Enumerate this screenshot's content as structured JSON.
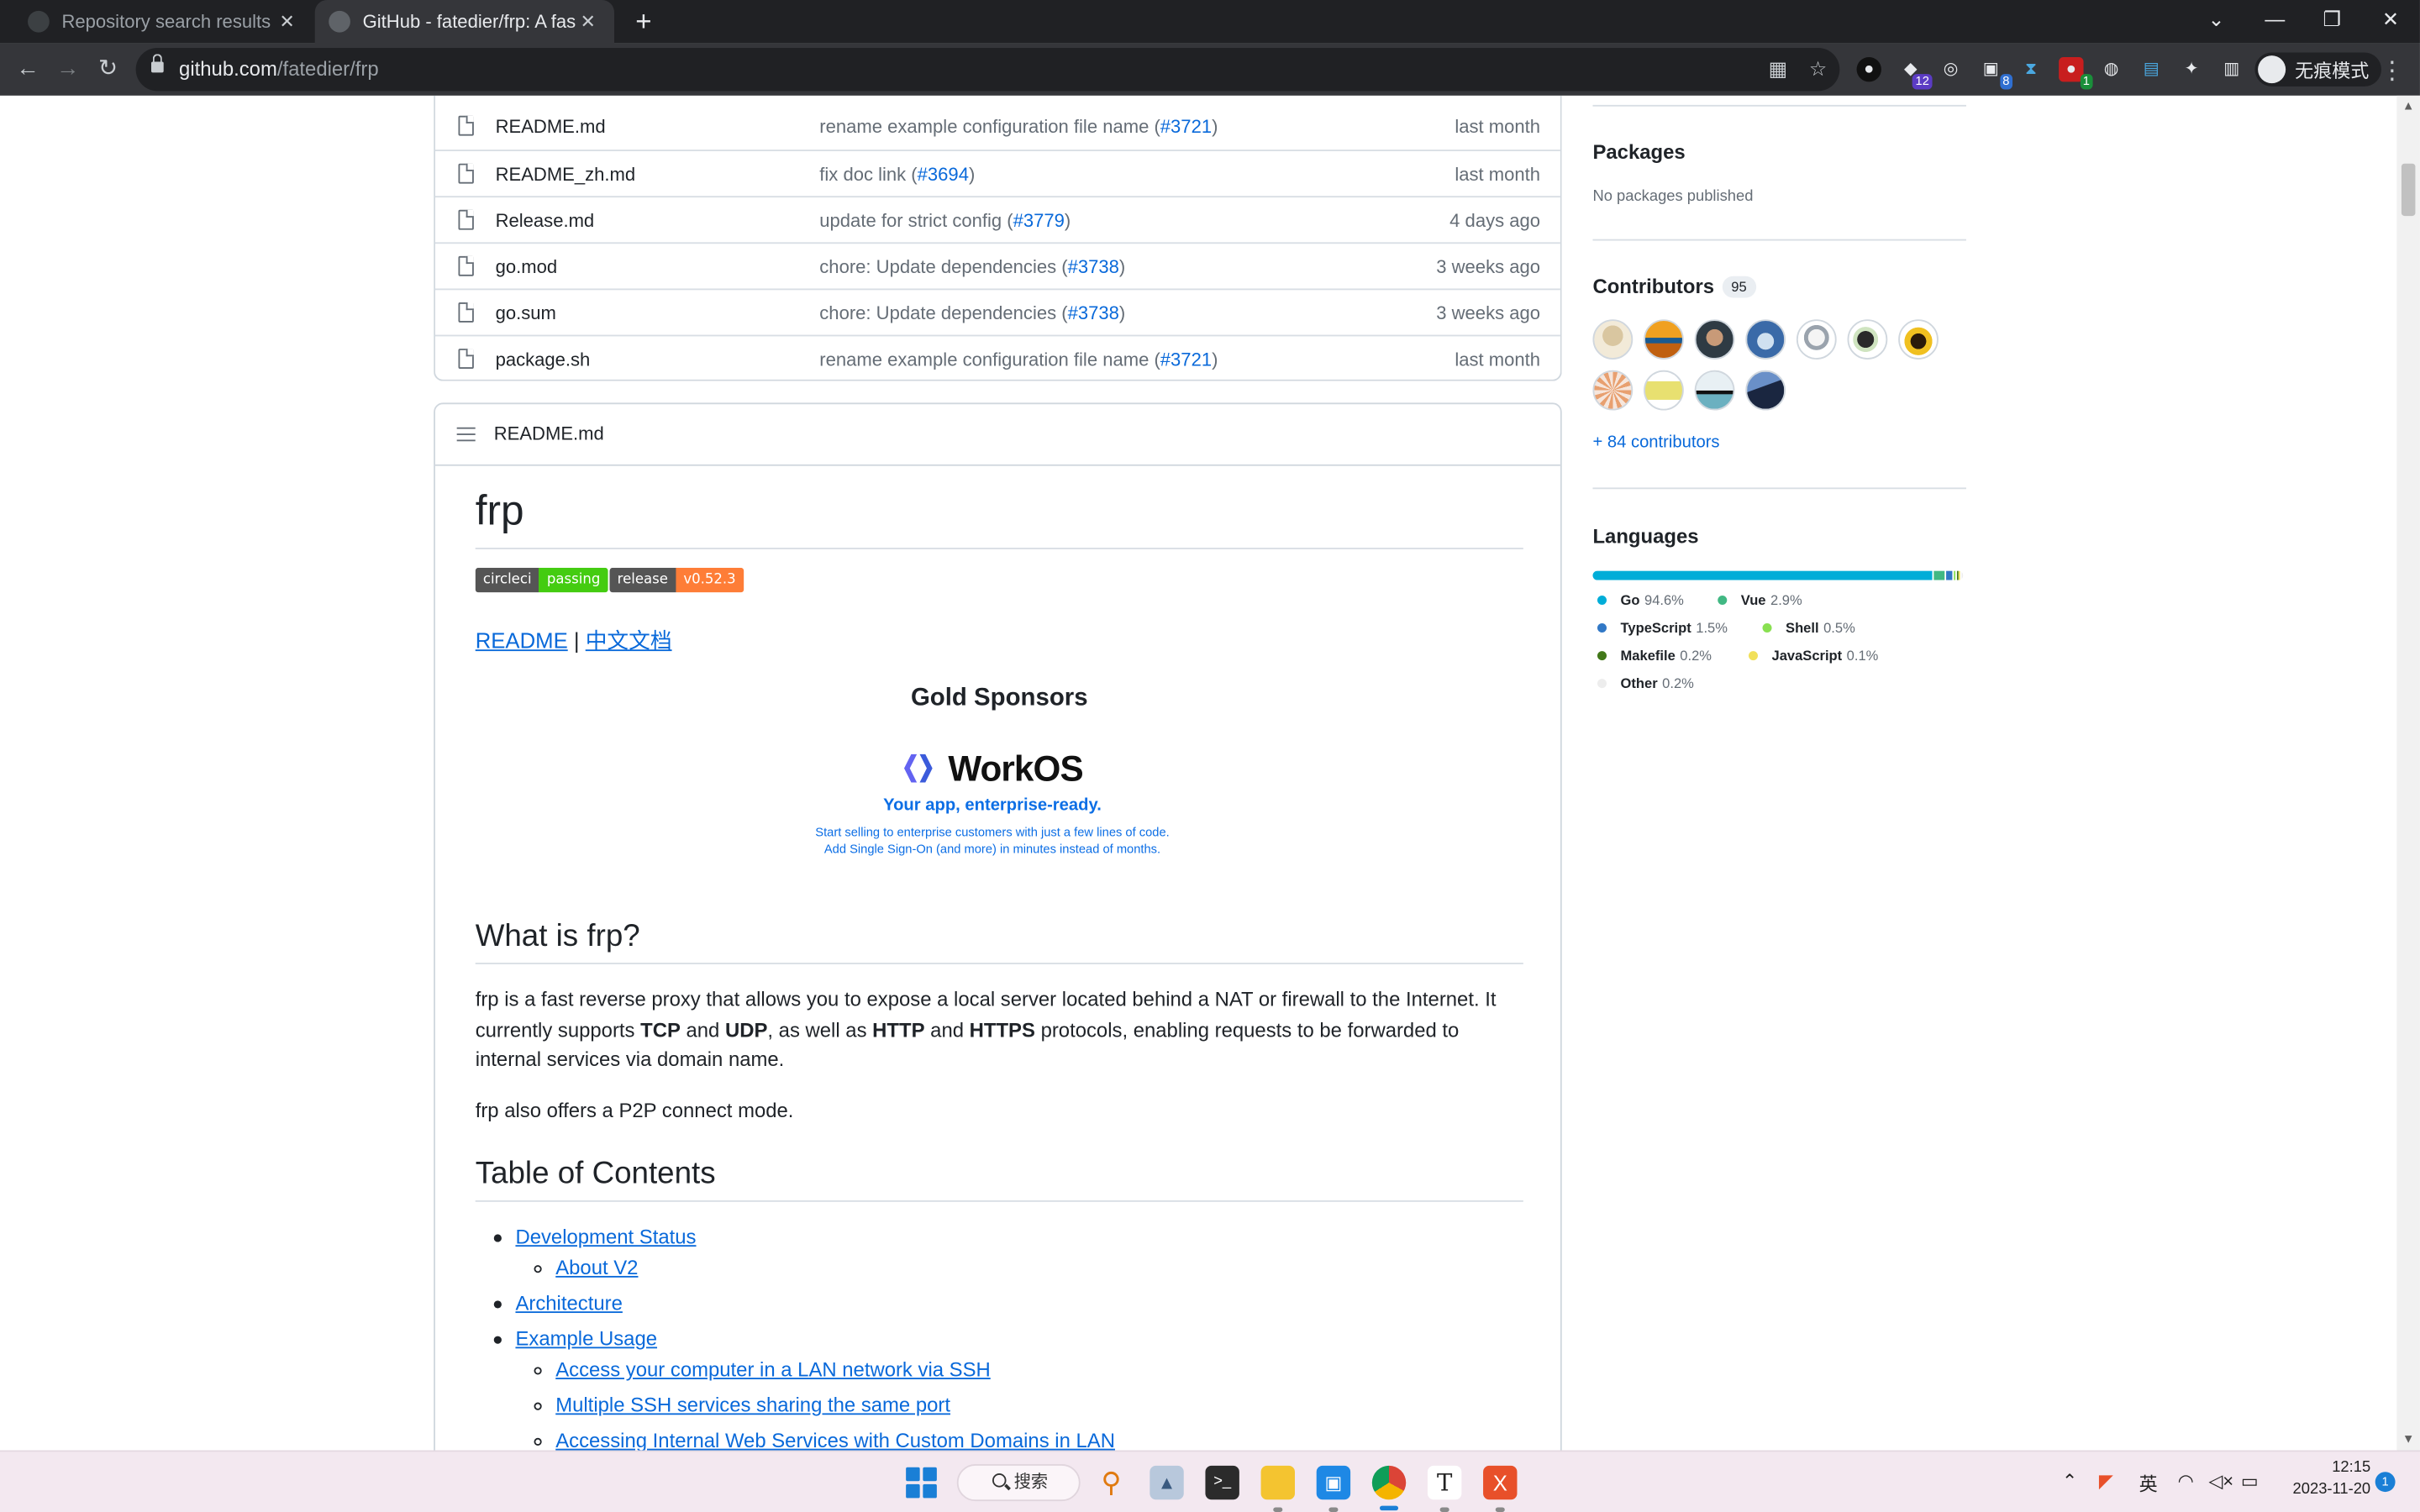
{
  "browser": {
    "tabs": [
      {
        "title": "Repository search results · Git",
        "active": false
      },
      {
        "title": "GitHub - fatedier/frp: A fast re",
        "active": true
      }
    ],
    "new_tab": "+",
    "url_host": "github.com",
    "url_path": "/fatedier/frp",
    "profile_label": "无痕模式",
    "extension_badges": [
      "12",
      "8",
      "1"
    ]
  },
  "files": [
    {
      "name": "README.md",
      "message": "rename example configuration file name (",
      "pr": "#3721",
      "close": ")",
      "time": "last month"
    },
    {
      "name": "README_zh.md",
      "message": "fix doc link (",
      "pr": "#3694",
      "close": ")",
      "time": "last month"
    },
    {
      "name": "Release.md",
      "message": "update for strict config (",
      "pr": "#3779",
      "close": ")",
      "time": "4 days ago"
    },
    {
      "name": "go.mod",
      "message": "chore: Update dependencies (",
      "pr": "#3738",
      "close": ")",
      "time": "3 weeks ago"
    },
    {
      "name": "go.sum",
      "message": "chore: Update dependencies (",
      "pr": "#3738",
      "close": ")",
      "time": "3 weeks ago"
    },
    {
      "name": "package.sh",
      "message": "rename example configuration file name (",
      "pr": "#3721",
      "close": ")",
      "time": "last month"
    }
  ],
  "readme": {
    "header": "README.md",
    "title": "frp",
    "badges": [
      {
        "left": "circleci",
        "right": "passing",
        "color": "#4c1"
      },
      {
        "left": "release",
        "right": "v0.52.3",
        "color": "#fe7d37"
      }
    ],
    "links": {
      "readme": "README",
      "sep": " | ",
      "zh": "中文文档"
    },
    "sponsors_title": "Gold Sponsors",
    "sponsor": {
      "name": "WorkOS",
      "tagline": "Your app, enterprise-ready.",
      "desc1": "Start selling to enterprise customers with just a few lines of code.",
      "desc2": "Add Single Sign-On (and more) in minutes instead of months."
    },
    "what_title": "What is frp?",
    "what_p1_a": "frp is a fast reverse proxy that allows you to expose a local server located behind a NAT or firewall to the Internet. It currently supports ",
    "tcp": "TCP",
    "and1": " and ",
    "udp": "UDP",
    "as_well": ", as well as ",
    "http": "HTTP",
    "and2": " and ",
    "https": "HTTPS",
    "what_p1_b": " protocols, enabling requests to be forwarded to internal services via domain name.",
    "what_p2": "frp also offers a P2P connect mode.",
    "toc_title": "Table of Contents",
    "toc": [
      {
        "label": "Development Status",
        "level": 1
      },
      {
        "label": "About V2",
        "level": 2
      },
      {
        "label": "Architecture",
        "level": 1
      },
      {
        "label": "Example Usage",
        "level": 1
      },
      {
        "label": "Access your computer in a LAN network via SSH",
        "level": 2
      },
      {
        "label": "Multiple SSH services sharing the same port",
        "level": 2
      },
      {
        "label": "Accessing Internal Web Services with Custom Domains in LAN",
        "level": 2
      }
    ]
  },
  "sidebar": {
    "packages_title": "Packages",
    "packages_text": "No packages published",
    "contributors_title": "Contributors",
    "contributors_count": "95",
    "more_contributors": "+ 84 contributors",
    "languages_title": "Languages",
    "languages": [
      {
        "name": "Go",
        "pct": "94.6%",
        "value": 94.6,
        "color": "#00ADD8"
      },
      {
        "name": "Vue",
        "pct": "2.9%",
        "value": 2.9,
        "color": "#41b883"
      },
      {
        "name": "TypeScript",
        "pct": "1.5%",
        "value": 1.5,
        "color": "#3178c6"
      },
      {
        "name": "Shell",
        "pct": "0.5%",
        "value": 0.5,
        "color": "#89e051"
      },
      {
        "name": "Makefile",
        "pct": "0.2%",
        "value": 0.2,
        "color": "#427819"
      },
      {
        "name": "JavaScript",
        "pct": "0.1%",
        "value": 0.1,
        "color": "#f1e05a"
      },
      {
        "name": "Other",
        "pct": "0.2%",
        "value": 0.2,
        "color": "#ededed"
      }
    ]
  },
  "taskbar": {
    "search_label": "搜索",
    "ime": "英",
    "time": "12:15",
    "date": "2023-11-20",
    "notification_count": "1"
  }
}
